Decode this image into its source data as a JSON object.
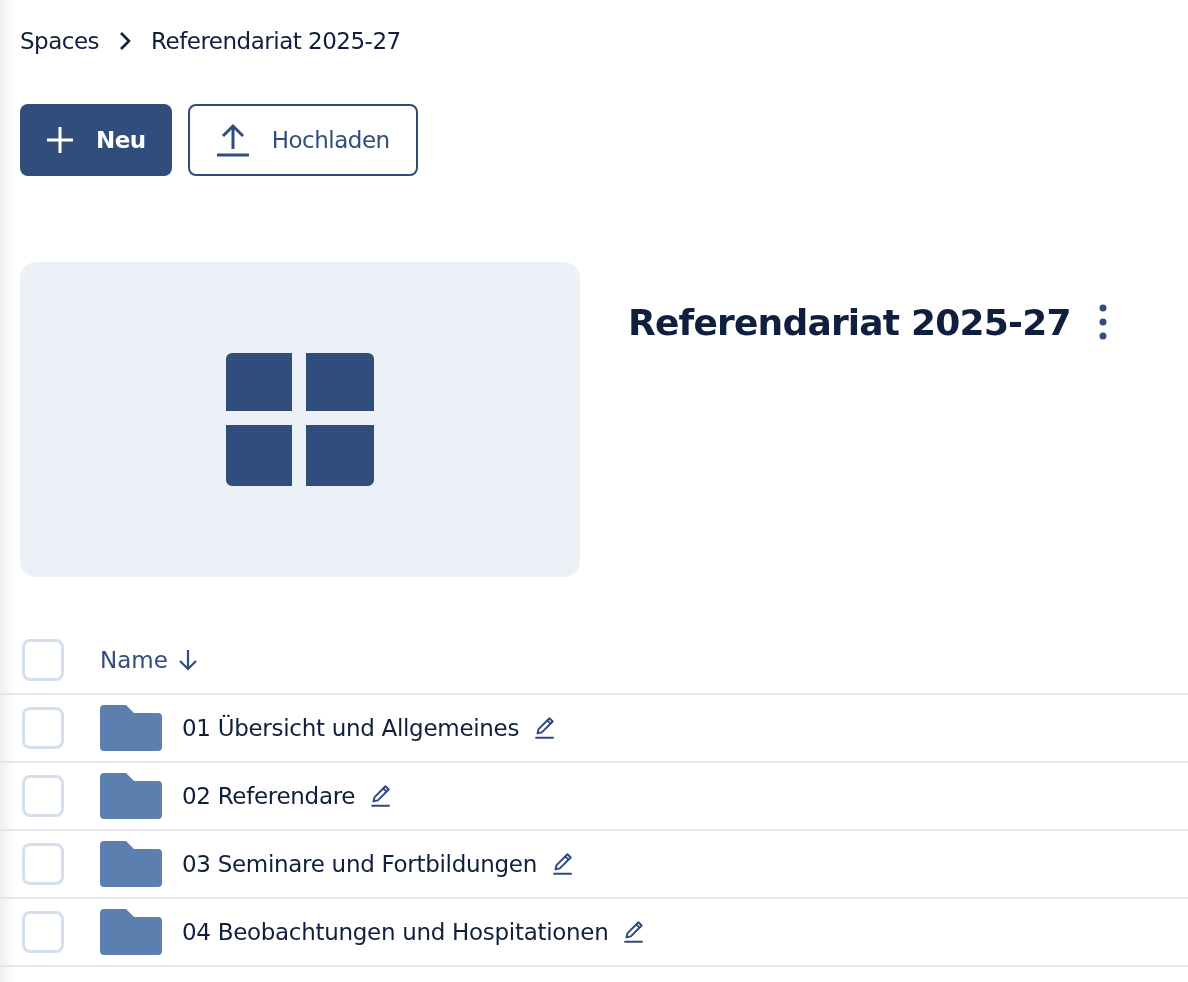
{
  "breadcrumb": [
    {
      "label": "Spaces"
    },
    {
      "label": "Referendariat 2025-27"
    }
  ],
  "actions": [
    {
      "label": "Neu",
      "kind": "primary"
    },
    {
      "label": "Hochladen",
      "kind": "upload"
    }
  ],
  "space": {
    "title": "Referendariat 2025-27"
  },
  "table": {
    "select_all": {
      "checked": false
    },
    "columns": [
      {
        "label": "Name",
        "sorted_descending": true
      }
    ],
    "rows": [
      {
        "name": "01 Übersicht und Allgemeines",
        "checked": false
      },
      {
        "name": "02 Referendare",
        "checked": false
      },
      {
        "name": "03 Seminare und Fortbildungen",
        "checked": false
      },
      {
        "name": "04 Beobachtungen und Hospitationen",
        "checked": false
      }
    ]
  }
}
